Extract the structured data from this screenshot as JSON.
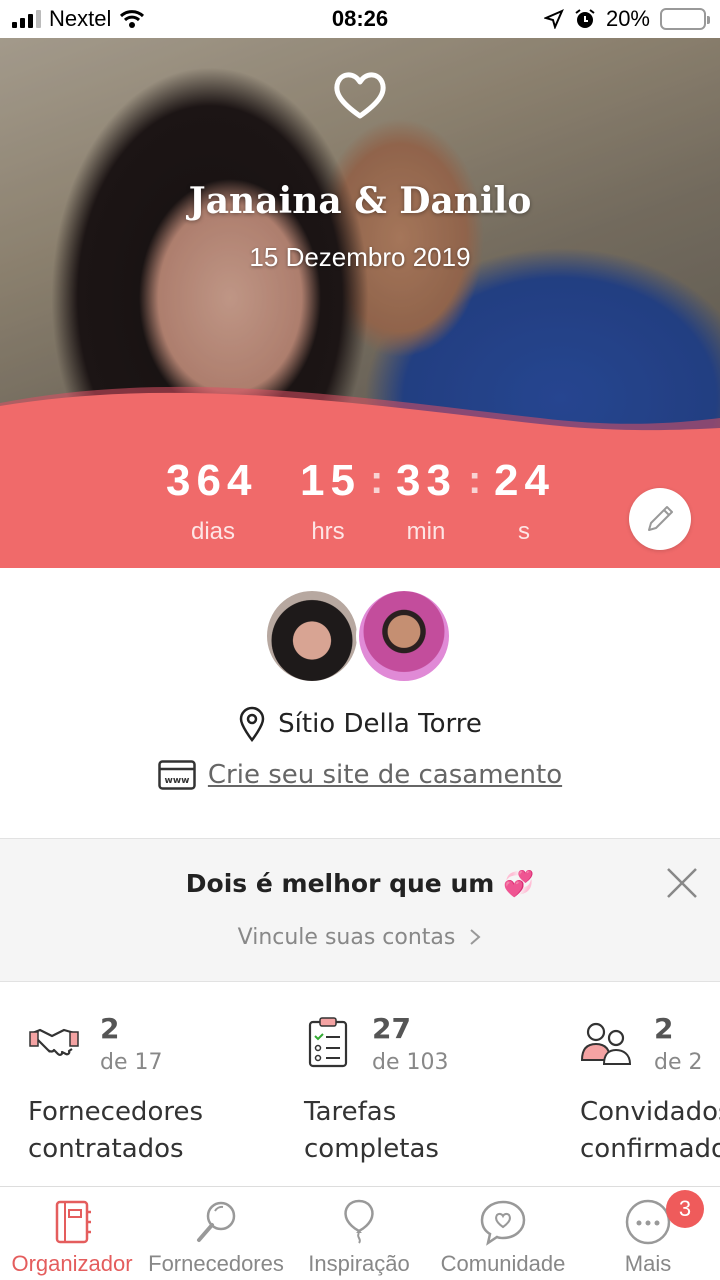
{
  "status_bar": {
    "carrier": "Nextel",
    "time": "08:26",
    "battery": "20%"
  },
  "hero": {
    "couple_names": "Janaina & Danilo",
    "wedding_date": "15 Dezembro 2019",
    "countdown": {
      "days": "364",
      "days_label": "dias",
      "hours": "15",
      "hours_label": "hrs",
      "minutes": "33",
      "minutes_label": "min",
      "seconds": "24",
      "seconds_label": "s"
    }
  },
  "venue": {
    "name": "Sítio Della Torre"
  },
  "website": {
    "link_text": "Crie seu site de casamento"
  },
  "promo": {
    "title": "Dois é melhor que um",
    "emoji": "💞",
    "link": "Vincule suas contas"
  },
  "stats": [
    {
      "value": "2",
      "of": "de 17",
      "label_line1": "Fornecedores",
      "label_line2": "contratados"
    },
    {
      "value": "27",
      "of": "de 103",
      "label_line1": "Tarefas",
      "label_line2": "completas"
    },
    {
      "value": "2",
      "of": "de 2",
      "label_line1": "Convidados",
      "label_line2": "confirmados"
    }
  ],
  "tabs": [
    {
      "label": "Organizador",
      "icon": "notebook-icon"
    },
    {
      "label": "Fornecedores",
      "icon": "magnifier-icon"
    },
    {
      "label": "Inspiração",
      "icon": "balloon-icon"
    },
    {
      "label": "Comunidade",
      "icon": "chat-heart-icon"
    },
    {
      "label": "Mais",
      "icon": "more-icon",
      "badge": "3"
    }
  ],
  "colors": {
    "accent": "#f06a6a",
    "tab_active": "#e45d5d"
  }
}
